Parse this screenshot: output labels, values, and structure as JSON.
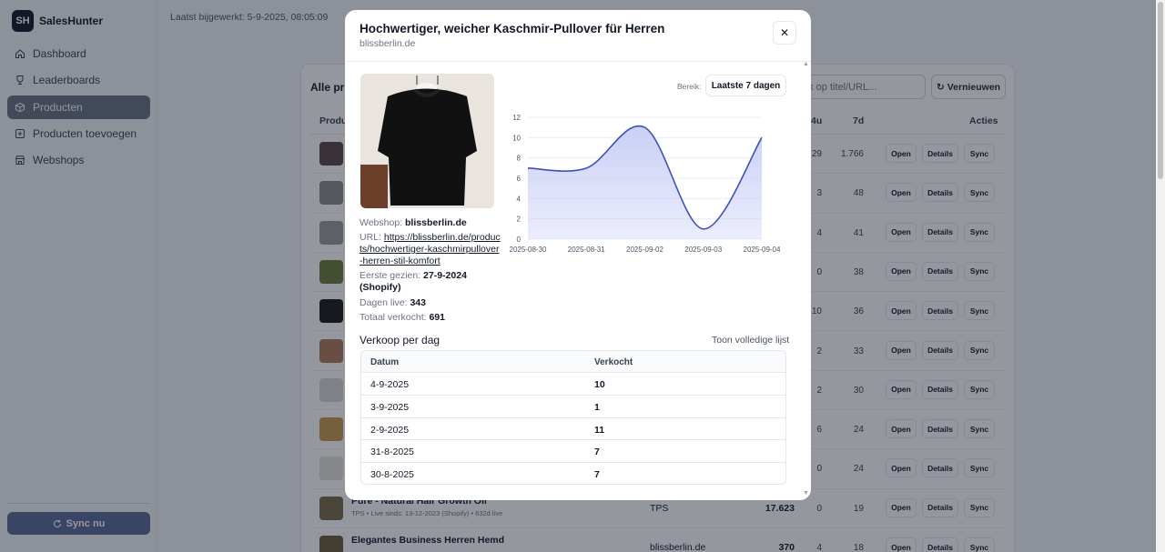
{
  "brand": {
    "logo": "SH",
    "name": "SalesHunter"
  },
  "nav": [
    {
      "label": "Dashboard",
      "icon": "home-icon"
    },
    {
      "label": "Leaderboards",
      "icon": "trophy-icon"
    },
    {
      "label": "Producten",
      "icon": "box-icon",
      "active": true
    },
    {
      "label": "Producten toevoegen",
      "icon": "plus-square-icon"
    },
    {
      "label": "Webshops",
      "icon": "store-icon"
    }
  ],
  "sidebar": {
    "sync_label": "Sync nu"
  },
  "topbar": {
    "last_updated": "Laatst bijgewerkt: 5-9-2025, 08:05:09"
  },
  "products": {
    "title": "Alle pro",
    "search_placeholder": "ek op titel/URL...",
    "refresh_label": "Vernieuwen",
    "headers": {
      "product": "Produc",
      "h24": "4u",
      "d7": "7d",
      "actions": "Acties"
    },
    "actions": {
      "open": "Open",
      "details": "Details",
      "sync": "Sync"
    },
    "rows": [
      {
        "h24": "29",
        "d7": "1.766"
      },
      {
        "h24": "3",
        "d7": "48"
      },
      {
        "h24": "4",
        "d7": "41"
      },
      {
        "h24": "0",
        "d7": "38"
      },
      {
        "h24": "10",
        "d7": "36"
      },
      {
        "h24": "2",
        "d7": "33"
      },
      {
        "h24": "2",
        "d7": "30"
      },
      {
        "h24": "6",
        "d7": "24"
      },
      {
        "h24": "0",
        "d7": "24"
      },
      {
        "title": "Pure - Natural Hair Growth Oil",
        "sub": "TPS • Live sinds: 13-12-2023 (Shopify) • 632d live",
        "shop": "TPS",
        "revenue": "17.623",
        "h24": "0",
        "d7": "19"
      },
      {
        "title": "Elegantes Business Herren Hemd",
        "shop": "blissberlin.de",
        "revenue": "370",
        "h24": "4",
        "d7": "18"
      }
    ]
  },
  "modal": {
    "title": "Hochwertiger, weicher Kaschmir-Pullover für Herren",
    "subtitle": "blissberlin.de",
    "close_label": "✕",
    "webshop_label": "Webshop:",
    "webshop": "blissberlin.de",
    "url_label": "URL:",
    "url": "https://blissberlin.de/products/hochwertiger-kaschmirpullover-herren-stil-komfort",
    "first_seen_label": "Eerste gezien:",
    "first_seen": "27-9-2024 (Shopify)",
    "days_live_label": "Dagen live:",
    "days_live": "343",
    "total_sold_label": "Totaal verkocht:",
    "total_sold": "691",
    "range_label": "Bereik:",
    "range_value": "Laatste 7 dagen",
    "sales_title": "Verkoop per dag",
    "show_full": "Toon volledige lijst",
    "table_headers": {
      "date": "Datum",
      "sold": "Verkocht"
    },
    "table_rows": [
      {
        "date": "4-9-2025",
        "sold": "10"
      },
      {
        "date": "3-9-2025",
        "sold": "1"
      },
      {
        "date": "2-9-2025",
        "sold": "11"
      },
      {
        "date": "31-8-2025",
        "sold": "7"
      },
      {
        "date": "30-8-2025",
        "sold": "7"
      }
    ]
  },
  "chart_data": {
    "type": "area",
    "x": [
      "2025-08-30",
      "2025-08-31",
      "2025-09-02",
      "2025-09-03",
      "2025-09-04"
    ],
    "values": [
      7,
      7,
      11,
      1,
      10
    ],
    "yticks": [
      0,
      2,
      4,
      6,
      8,
      10,
      12
    ],
    "ylim": [
      0,
      12
    ],
    "color": "#3b4fb8",
    "fill": "#c7cdf5"
  }
}
